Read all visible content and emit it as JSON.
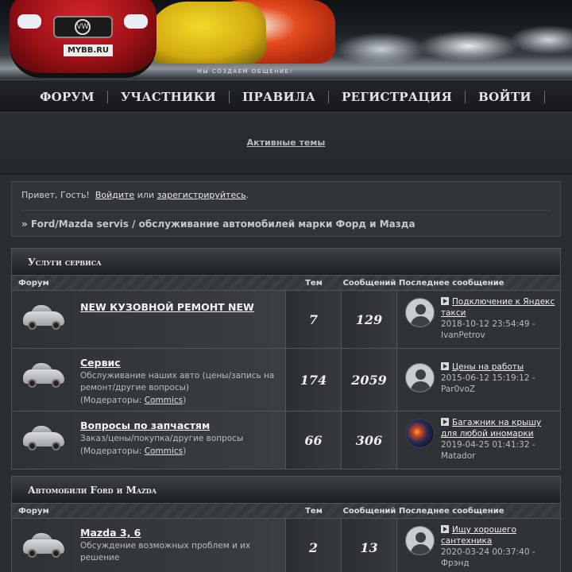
{
  "header": {
    "plate": "MYBB.RU",
    "tagline": "МЫ СОЗДАЕМ ОБЩЕНИЕ!"
  },
  "nav": {
    "items": [
      {
        "label": "ФОРУМ"
      },
      {
        "label": "УЧАСТНИКИ"
      },
      {
        "label": "ПРАВИЛА"
      },
      {
        "label": "РЕГИСТРАЦИЯ"
      },
      {
        "label": "ВОЙТИ"
      }
    ]
  },
  "active_topics": "Активные темы",
  "welcome": {
    "greeting": "Привет, Гость!",
    "login": "Войдите",
    "or": "или",
    "register": "зарегистрируйтесь",
    "period": ".",
    "breadcrumb": "» Ford/Mazda servis / обслуживание автомобилей марки Форд и Мазда"
  },
  "columns": {
    "forum": "Форум",
    "topics": "Тем",
    "posts": "Сообщений",
    "last": "Последнее сообщение"
  },
  "categories": [
    {
      "title": "Услуги сервиса",
      "forums": [
        {
          "name": "NEW КУЗОВНОЙ РЕМОНТ NEW",
          "desc": "",
          "topics": "7",
          "posts": "129",
          "last_topic": "Подключение к Яндекс такси",
          "last_meta": "2018-10-12 23:54:49 - IvanPetrov"
        },
        {
          "name": "Сервис",
          "desc": "Обслуживание наших авто (цены/запись на ремонт/другие вопросы)",
          "mod_prefix": "(Модераторы: ",
          "mod_name": "Commics",
          "mod_suffix": ")",
          "topics": "174",
          "posts": "2059",
          "last_topic": "Цены на работы",
          "last_meta": "2015-06-12 15:19:12 - Par0voZ"
        },
        {
          "name": "Вопросы по запчастям",
          "desc": "Заказ/цены/покупка/другие вопросы",
          "mod_prefix": "(Модераторы: ",
          "mod_name": "Commics",
          "mod_suffix": ")",
          "topics": "66",
          "posts": "306",
          "last_topic": "Багажник на крышу для любой иномарки",
          "last_meta": "2019-04-25 01:41:32 - Matador"
        }
      ]
    },
    {
      "title": "Автомобили Ford и Mazda",
      "forums": [
        {
          "name": "Mazda 3, 6",
          "desc": "Обсуждение возможных проблем и их решение",
          "topics": "2",
          "posts": "13",
          "last_topic": "Ищу хорошего сантехника",
          "last_meta": "2020-03-24 00:37:40 - Фрэнд"
        }
      ]
    }
  ]
}
